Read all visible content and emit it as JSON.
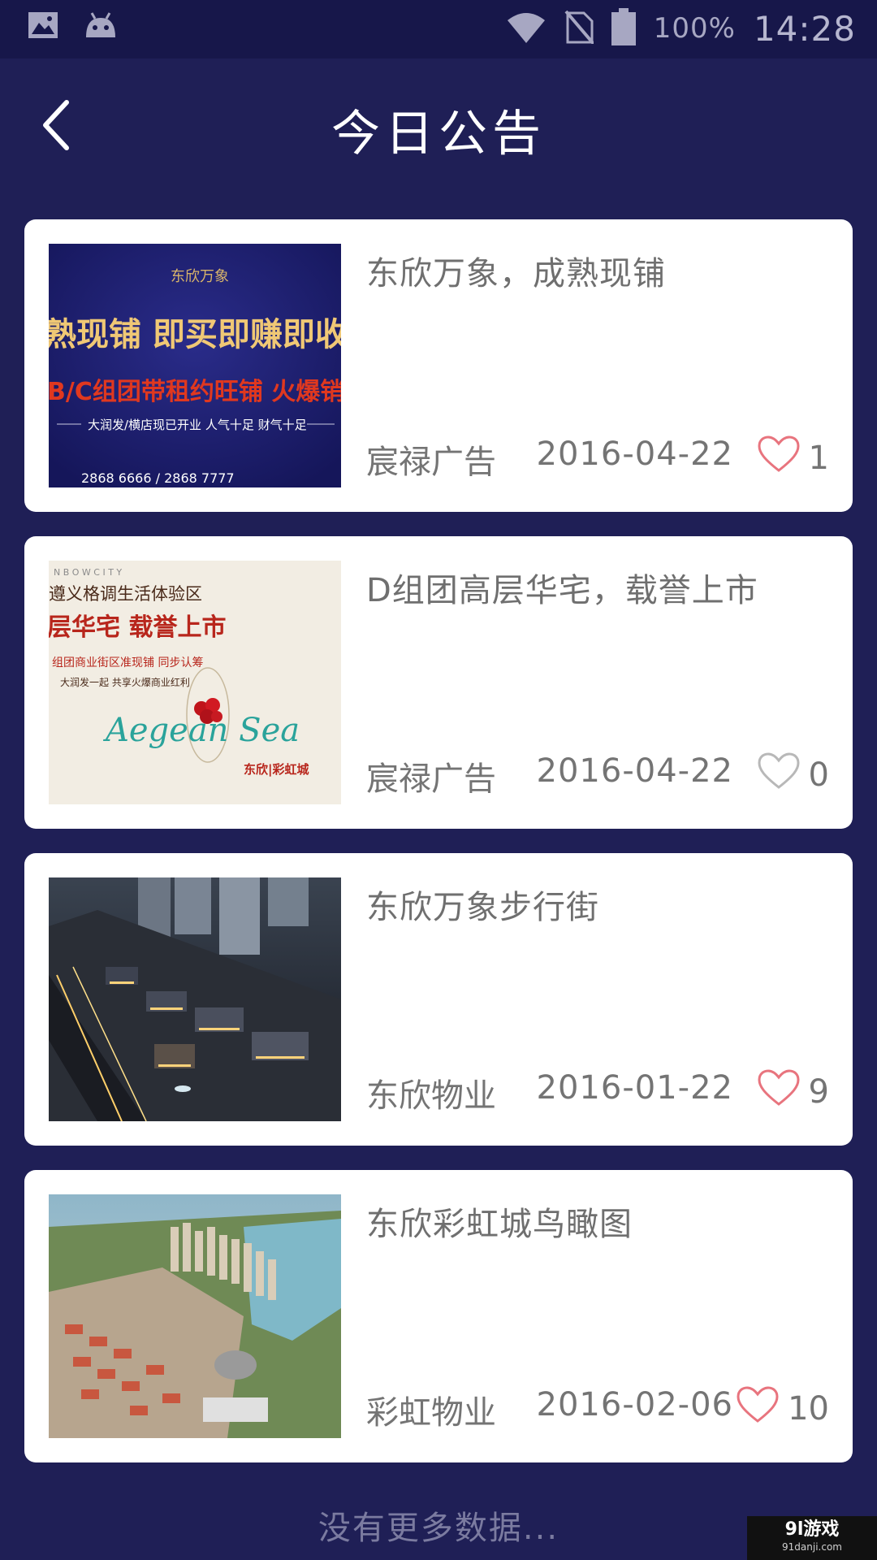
{
  "status_bar": {
    "battery_pct": "100%",
    "time": "14:28",
    "icons": [
      "image-icon",
      "android-icon",
      "wifi-icon",
      "no-sim-icon",
      "battery-icon"
    ]
  },
  "header": {
    "title": "今日公告",
    "back_icon": "chevron-left-icon"
  },
  "announcements": [
    {
      "title": "东欣万象，成熟现铺",
      "source": "宸禄广告",
      "date": "2016-04-22",
      "likes": "1",
      "liked": true,
      "thumb_text": {
        "brand": "东欣万象",
        "line1": "熟现铺  即买即赚即收",
        "line2": "B/C组团带租约旺铺  火爆销售",
        "line3": "大润发/横店现已开业  人气十足  财气十足",
        "phone": "2868 6666 / 2868 7777"
      }
    },
    {
      "title": "D组团高层华宅，载誉上市",
      "source": "宸禄广告",
      "date": "2016-04-22",
      "likes": "0",
      "liked": false,
      "thumb_text": {
        "top": "N B O W   C I T Y",
        "line1": "遵义格调生活体验区",
        "line2": "层华宅  载誉上市",
        "line3": "组团商业街区准现铺  同步认筹",
        "line4": "大润发一起  共享火爆商业红利",
        "script": "Aegean Sea",
        "brand": "东欣|彩虹城"
      }
    },
    {
      "title": "东欣万象步行街",
      "source": "东欣物业",
      "date": "2016-01-22",
      "likes": "9",
      "liked": true
    },
    {
      "title": "东欣彩虹城鸟瞰图",
      "source": "彩虹物业",
      "date": "2016-02-06",
      "likes": "10",
      "liked": true
    }
  ],
  "footer": {
    "no_more": "没有更多数据..."
  },
  "watermark": {
    "main": "9l游戏",
    "sub": "91danji.com"
  },
  "colors": {
    "background": "#1f1f56",
    "status_bar": "#17174a",
    "card": "#ffffff",
    "heart_liked": "#e8747e",
    "heart_unliked": "#b8b8b8"
  }
}
